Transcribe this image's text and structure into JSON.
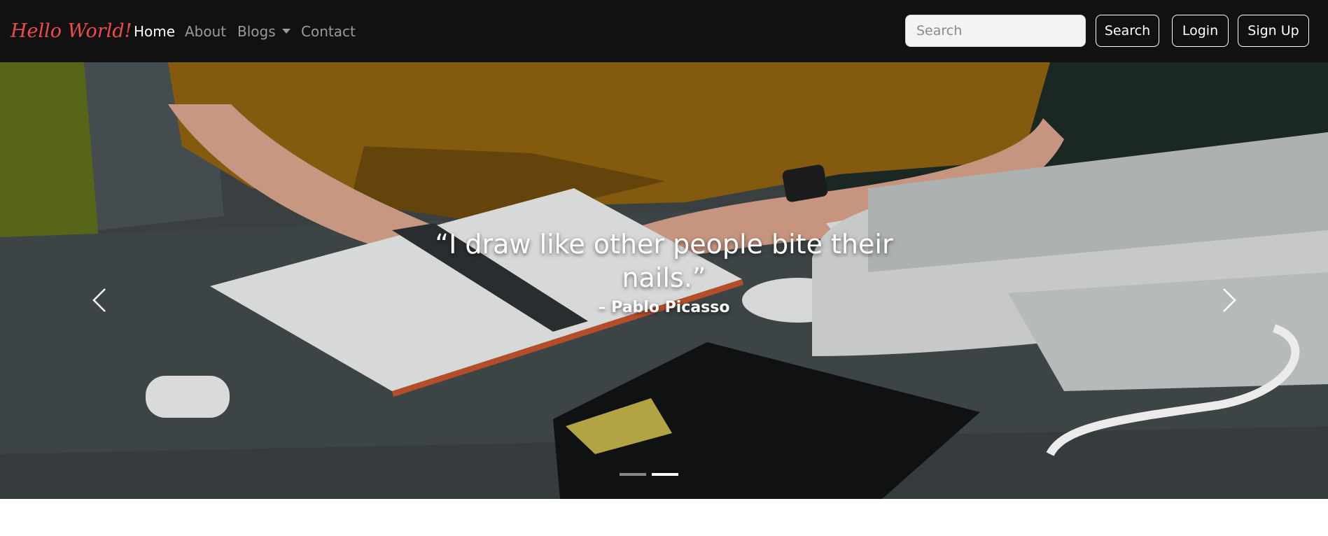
{
  "brand": "Hello World!",
  "nav": {
    "items": [
      {
        "label": "Home",
        "active": true
      },
      {
        "label": "About",
        "active": false
      },
      {
        "label": "Blogs",
        "active": false,
        "dropdown": true
      },
      {
        "label": "Contact",
        "active": false
      }
    ]
  },
  "search": {
    "placeholder": "Search",
    "value": "",
    "button_label": "Search"
  },
  "auth": {
    "login_label": "Login",
    "signup_label": "Sign Up"
  },
  "carousel": {
    "quote": "“I draw like other people bite their nails.”",
    "author": "– Pablo Picasso",
    "prev_icon": "chevron-left-icon",
    "next_icon": "chevron-right-icon",
    "slide_count": 2,
    "active_slide": 2
  },
  "colors": {
    "navbar_bg": "#111111",
    "brand": "#ef4b4b",
    "nav_active": "#ffffff",
    "nav_inactive": "#9a9a9a"
  }
}
